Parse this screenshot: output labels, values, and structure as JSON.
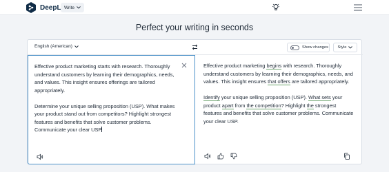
{
  "app": {
    "name": "DeepL",
    "mode_label": "Write"
  },
  "page_title": "Perfect your writing in seconds",
  "toolbar": {
    "language": "English (American)",
    "show_changes_label": "Show changes",
    "style_label": "Style"
  },
  "source": {
    "paragraphs": [
      "Effective product marketing starts with research. Thoroughly understand customers by learning their demographics, needs, and values. This insight ensures offerings are tailored appropriately.",
      "Determine your unique selling proposition (USP). What makes your product stand out from competitors? Highlight strongest features and benefits that solve customer problems. Communicate your clear USP"
    ]
  },
  "target": {
    "paragraphs": [
      [
        {
          "t": "Effective product marketing "
        },
        {
          "t": "begins",
          "changed": true
        },
        {
          "t": " with research. Thoroughly understand customers by learning their demographics, needs, and values. This insight ensures "
        },
        {
          "t": "that offers",
          "changed": true
        },
        {
          "t": " are tailored appropriately."
        }
      ],
      [
        {
          "t": "Identify",
          "changed": true
        },
        {
          "t": " your unique selling proposition (USP). "
        },
        {
          "t": "What sets",
          "changed": true
        },
        {
          "t": " your product "
        },
        {
          "t": "apart",
          "changed": true
        },
        {
          "t": " from "
        },
        {
          "t": "the competition",
          "changed": true
        },
        {
          "t": "? Highlight "
        },
        {
          "t": "the",
          "changed": true
        },
        {
          "t": " strongest features and benefits that solve customer problems. Communicate your clear USP."
        }
      ]
    ]
  },
  "colors": {
    "accent": "#4a90c8",
    "change_underline": "#6ba36b",
    "brand": "#0f2b46"
  }
}
